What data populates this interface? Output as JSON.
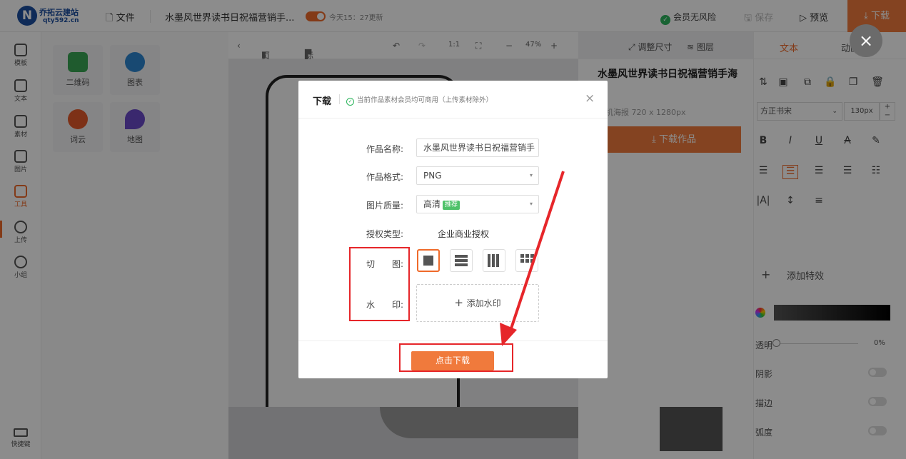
{
  "header": {
    "logo_name": "乔拓云建站",
    "logo_url": "qty592.cn",
    "file_label": "文件",
    "doc_title": "水墨风世界读书日祝福营销手...",
    "saved_text": "今天15：27更新",
    "risk_label": "会员无风险",
    "save_label": "保存",
    "preview_label": "预览",
    "download_label": "下载"
  },
  "sidebar": {
    "items": [
      {
        "label": "模板"
      },
      {
        "label": "文本"
      },
      {
        "label": "素材"
      },
      {
        "label": "图片"
      },
      {
        "label": "工具"
      },
      {
        "label": "上传"
      },
      {
        "label": "小组"
      }
    ],
    "shortcut_label": "快捷键"
  },
  "tools": [
    {
      "label": "二维码"
    },
    {
      "label": "图表"
    },
    {
      "label": "词云"
    },
    {
      "label": "地图"
    }
  ],
  "canvas_toolbar": {
    "page_label": "页面",
    "ruler_label": "标尺",
    "ratio_label": "1:1",
    "zoom_label": "47%"
  },
  "right_info": {
    "work_name": "水墨风世界读书日祝福营销手海报",
    "size_text": "手机海报 720 x 1280px",
    "download_work_label": "下载作品",
    "resize_label": "调整尺寸",
    "layers_label": "图层"
  },
  "panel": {
    "tab_text": "文本",
    "tab_anim": "动画",
    "font_name": "方正书宋",
    "font_size": "130px",
    "add_effect_label": "添加特效",
    "opacity_label": "透明",
    "opacity_value": "0%",
    "shadow_label": "阴影",
    "stroke_label": "描边",
    "radius_label": "弧度"
  },
  "modal": {
    "title": "下载",
    "note": "当前作品素材会员均可商用（上传素材除外）",
    "name_label": "作品名称:",
    "name_value": "水墨风世界读书日祝福营销手",
    "format_label": "作品格式:",
    "format_value": "PNG",
    "quality_label": "图片质量:",
    "quality_value": "高清",
    "quality_badge": "推荐",
    "license_label": "授权类型:",
    "license_value": "企业商业授权",
    "crop_label_a": "切",
    "crop_label_b": "图:",
    "watermark_label_a": "水",
    "watermark_label_b": "印:",
    "add_watermark_label": "添加水印",
    "download_button": "点击下载"
  },
  "colors": {
    "accent": "#f07a3c",
    "annotation_red": "#e6262a",
    "success_green": "#2db55d"
  }
}
